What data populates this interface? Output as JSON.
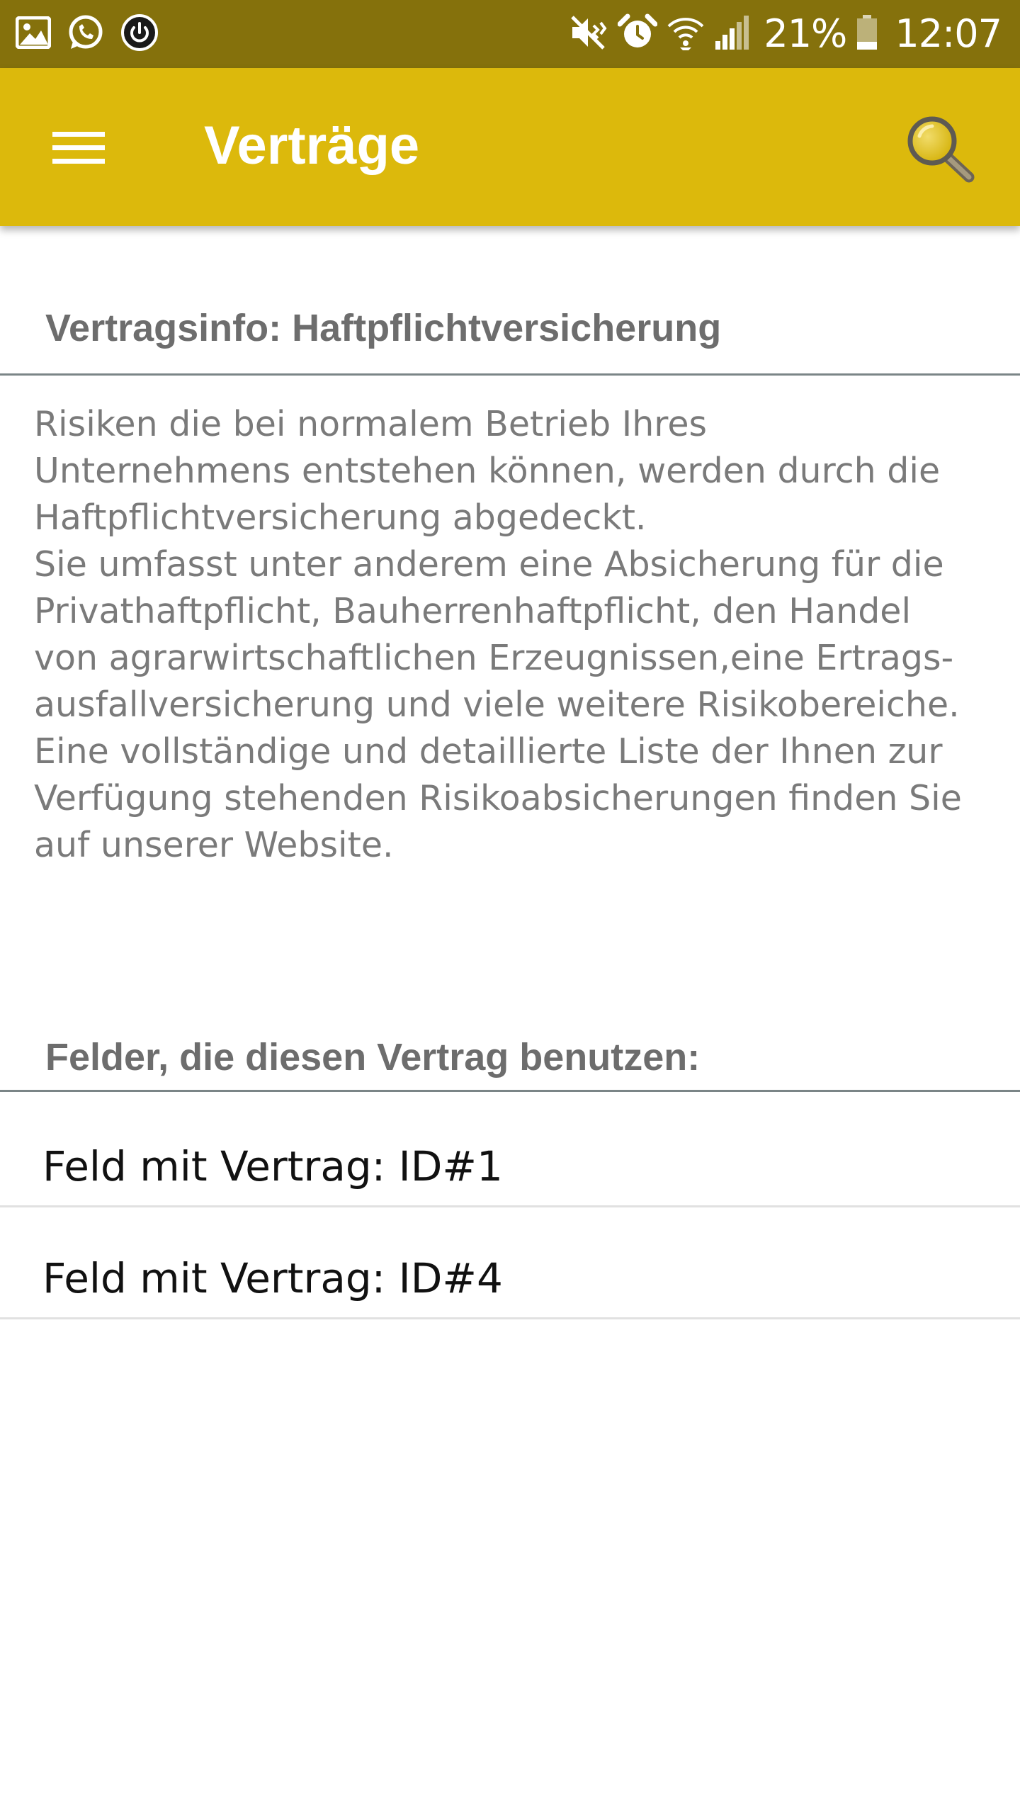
{
  "status_bar": {
    "left_icons": [
      "gallery-icon",
      "whatsapp-icon",
      "power-app-icon"
    ],
    "right_icons": [
      "vibrate-icon",
      "alarm-icon",
      "wifi-icon",
      "signal-icon",
      "battery-icon"
    ],
    "battery": "21%",
    "time": "12:07"
  },
  "app_bar": {
    "title": "Verträge",
    "menu_icon": "hamburger-menu-icon",
    "search_icon": "search-icon",
    "background": "#dcb90c",
    "status_background": "#85710c"
  },
  "contract_info": {
    "header": "Vertragsinfo: Haftpflichtversicherung",
    "description": "Risiken die bei normalem Betrieb Ihres\nUnternehmens entstehen können, werden durch die\nHaftpflichtversicherung abgedeckt.\n Sie umfasst unter anderem eine Absicherung für die\nPrivathaftpflicht, Bauherrenhaftpflicht, den Handel\nvon agrarwirtschaftlichen Erzeugnissen,eine Ertrags-\nausfallversicherung und viele weitere Risikobereiche.\nEine vollständige und detaillierte Liste der Ihnen zur\nVerfügung stehenden Risikoabsicherungen finden Sie\nauf unserer Website."
  },
  "fields_section": {
    "header": "Felder, die diesen Vertrag benutzen:",
    "items": [
      {
        "label": "Feld mit Vertrag: ID#1"
      },
      {
        "label": "Feld mit Vertrag: ID#4"
      }
    ]
  }
}
